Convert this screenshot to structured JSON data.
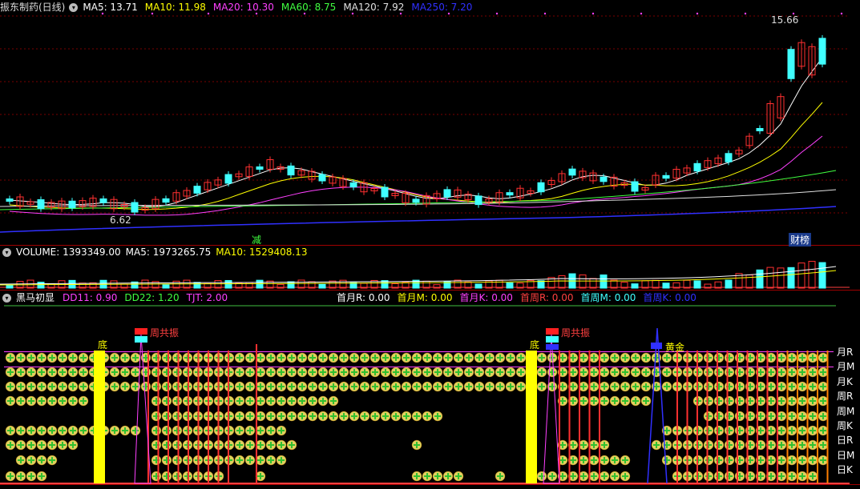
{
  "main_header": {
    "title": "振东制药(日线)",
    "indicators": [
      {
        "label": "MA5: 13.71",
        "color": "#ffffff"
      },
      {
        "label": "MA10: 11.98",
        "color": "#ffff00"
      },
      {
        "label": "MA20: 10.30",
        "color": "#ff40ff"
      },
      {
        "label": "MA60: 8.75",
        "color": "#40ff40"
      },
      {
        "label": "MA120: 7.92",
        "color": "#e0e0e0"
      },
      {
        "label": "MA250: 7.20",
        "color": "#3030ff"
      }
    ]
  },
  "price_labels": {
    "high": "15.66",
    "low": "6.62"
  },
  "markers": {
    "jian": "减",
    "caibang": "财榜"
  },
  "volume_header": {
    "label": "VOLUME: 1393349.00",
    "ma5": "MA5: 1973265.75",
    "ma10": "MA10: 1529408.13"
  },
  "indicator_header": {
    "title": "黑马初显",
    "values": [
      {
        "label": "DD11: 0.90",
        "color": "#ff40ff"
      },
      {
        "label": "DD22: 1.20",
        "color": "#40ff40"
      },
      {
        "label": "TJT: 2.00",
        "color": "#ff40ff"
      }
    ],
    "right_values": [
      {
        "label": "首月R: 0.00",
        "color": "#ffffff"
      },
      {
        "label": "首月M: 0.00",
        "color": "#ffff00"
      },
      {
        "label": "首月K: 0.00",
        "color": "#ff40ff"
      },
      {
        "label": "首周R: 0.00",
        "color": "#ff4040"
      },
      {
        "label": "首周M: 0.00",
        "color": "#40ffff"
      },
      {
        "label": "首周K: 0.00",
        "color": "#3030ff"
      }
    ]
  },
  "signal_labels": {
    "di": "底",
    "zhou_gong_zhen": "周共振",
    "huang_jin": "黄金",
    "row_labels": [
      "月R",
      "月M",
      "月K",
      "周R",
      "周M",
      "周K",
      "日R",
      "日M",
      "日K"
    ]
  },
  "colors": {
    "up": "#ff3030",
    "down": "#40ffff",
    "grid": "#a00000"
  }
}
